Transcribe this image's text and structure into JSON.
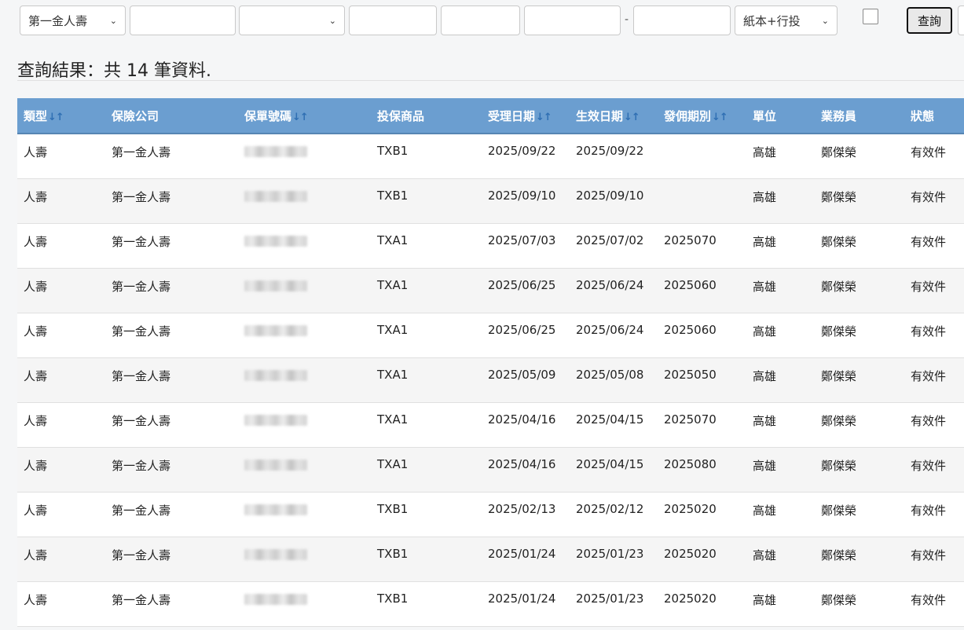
{
  "filters": {
    "company_select": "第一金人壽",
    "type_select": "紙本+行投",
    "date_separator": "-",
    "query_button": "查詢"
  },
  "result_summary": "查詢結果：共 14 筆資料.",
  "table": {
    "headers": [
      {
        "label": "類型",
        "sortable": true
      },
      {
        "label": "保險公司",
        "sortable": false
      },
      {
        "label": "保單號碼",
        "sortable": true
      },
      {
        "label": "投保商品",
        "sortable": false
      },
      {
        "label": "受理日期",
        "sortable": true
      },
      {
        "label": "生效日期",
        "sortable": true
      },
      {
        "label": "發佣期別",
        "sortable": true
      },
      {
        "label": "單位",
        "sortable": false
      },
      {
        "label": "業務員",
        "sortable": false
      },
      {
        "label": "狀態",
        "sortable": false
      }
    ],
    "sort_icon": "↓↑",
    "policy_number_redacted": true,
    "rows": [
      [
        "人壽",
        "第一金人壽",
        "",
        "TXB1",
        "2025/09/22",
        "2025/09/22",
        "",
        "高雄",
        "鄭傑榮",
        "有效件"
      ],
      [
        "人壽",
        "第一金人壽",
        "",
        "TXB1",
        "2025/09/10",
        "2025/09/10",
        "",
        "高雄",
        "鄭傑榮",
        "有效件"
      ],
      [
        "人壽",
        "第一金人壽",
        "",
        "TXA1",
        "2025/07/03",
        "2025/07/02",
        "2025070",
        "高雄",
        "鄭傑榮",
        "有效件"
      ],
      [
        "人壽",
        "第一金人壽",
        "",
        "TXA1",
        "2025/06/25",
        "2025/06/24",
        "2025060",
        "高雄",
        "鄭傑榮",
        "有效件"
      ],
      [
        "人壽",
        "第一金人壽",
        "",
        "TXA1",
        "2025/06/25",
        "2025/06/24",
        "2025060",
        "高雄",
        "鄭傑榮",
        "有效件"
      ],
      [
        "人壽",
        "第一金人壽",
        "",
        "TXA1",
        "2025/05/09",
        "2025/05/08",
        "2025050",
        "高雄",
        "鄭傑榮",
        "有效件"
      ],
      [
        "人壽",
        "第一金人壽",
        "",
        "TXA1",
        "2025/04/16",
        "2025/04/15",
        "2025070",
        "高雄",
        "鄭傑榮",
        "有效件"
      ],
      [
        "人壽",
        "第一金人壽",
        "",
        "TXA1",
        "2025/04/16",
        "2025/04/15",
        "2025080",
        "高雄",
        "鄭傑榮",
        "有效件"
      ],
      [
        "人壽",
        "第一金人壽",
        "",
        "TXB1",
        "2025/02/13",
        "2025/02/12",
        "2025020",
        "高雄",
        "鄭傑榮",
        "有效件"
      ],
      [
        "人壽",
        "第一金人壽",
        "",
        "TXB1",
        "2025/01/24",
        "2025/01/23",
        "2025020",
        "高雄",
        "鄭傑榮",
        "有效件"
      ],
      [
        "人壽",
        "第一金人壽",
        "",
        "TXB1",
        "2025/01/24",
        "2025/01/23",
        "2025020",
        "高雄",
        "鄭傑榮",
        "有效件"
      ]
    ]
  },
  "colors": {
    "header_bg": "#6b9ed0",
    "header_text": "#ffffff",
    "sort_icon": "#2f6fb3",
    "row_alt": "#f5f5f5"
  }
}
